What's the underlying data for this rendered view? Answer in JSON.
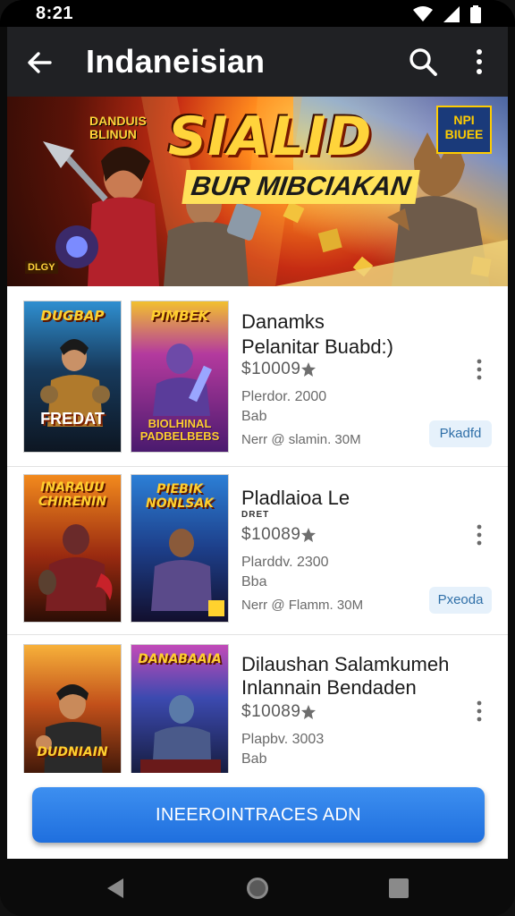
{
  "status_bar": {
    "time": "8:21"
  },
  "app_bar": {
    "title": "Indaneisian"
  },
  "banner": {
    "title": "SIALID",
    "subtitle": "BUR MIBCIAKAN",
    "badge_left": "DANDUIS BLINUN",
    "badge_right": "NPI BIUEE",
    "corner_tag": "DLGY"
  },
  "items": [
    {
      "poster_a": {
        "title": "DUGBAP",
        "caption": "FREDAT"
      },
      "poster_b": {
        "title": "PIMBEK",
        "caption": "BIOLHINAL PADBELBEBS"
      },
      "title_lines": [
        "Danamks",
        "Pelanitar Buabd:)"
      ],
      "tag": "",
      "price": "$10009",
      "meta_lines": [
        "Plerdor. 2000",
        "Bab"
      ],
      "downloads": "Nerr @ slamin. 30M",
      "chip": "Pkadfd"
    },
    {
      "poster_a": {
        "title": "INARAUU CHIRENIN",
        "caption": ""
      },
      "poster_b": {
        "title": "PIEBIK NONLSAK",
        "caption": ""
      },
      "title_lines": [
        "Pladlaioa Le"
      ],
      "tag": "DRET",
      "price": "$10089",
      "meta_lines": [
        "Plarddv. 2300",
        "Bba"
      ],
      "downloads": "Nerr @ Flamm. 30M",
      "chip": "Pxeoda"
    },
    {
      "poster_a": {
        "title": "DUDNIAIN",
        "caption": ""
      },
      "poster_b": {
        "title": "DANABAAIA",
        "caption": ""
      },
      "title_lines": [
        "Dilaushan Salamkumeh",
        "Inlannain Bendaden"
      ],
      "tag": "",
      "price": "$10089",
      "meta_lines": [
        "Plapbv. 3003",
        "Bab"
      ],
      "downloads": "",
      "chip": ""
    }
  ],
  "action": {
    "button_label": "INEEROINTRACES ADN"
  },
  "colors": {
    "accent": "#1f6fde",
    "app_bar": "#202124",
    "chip_bg": "#e6f1fb"
  }
}
